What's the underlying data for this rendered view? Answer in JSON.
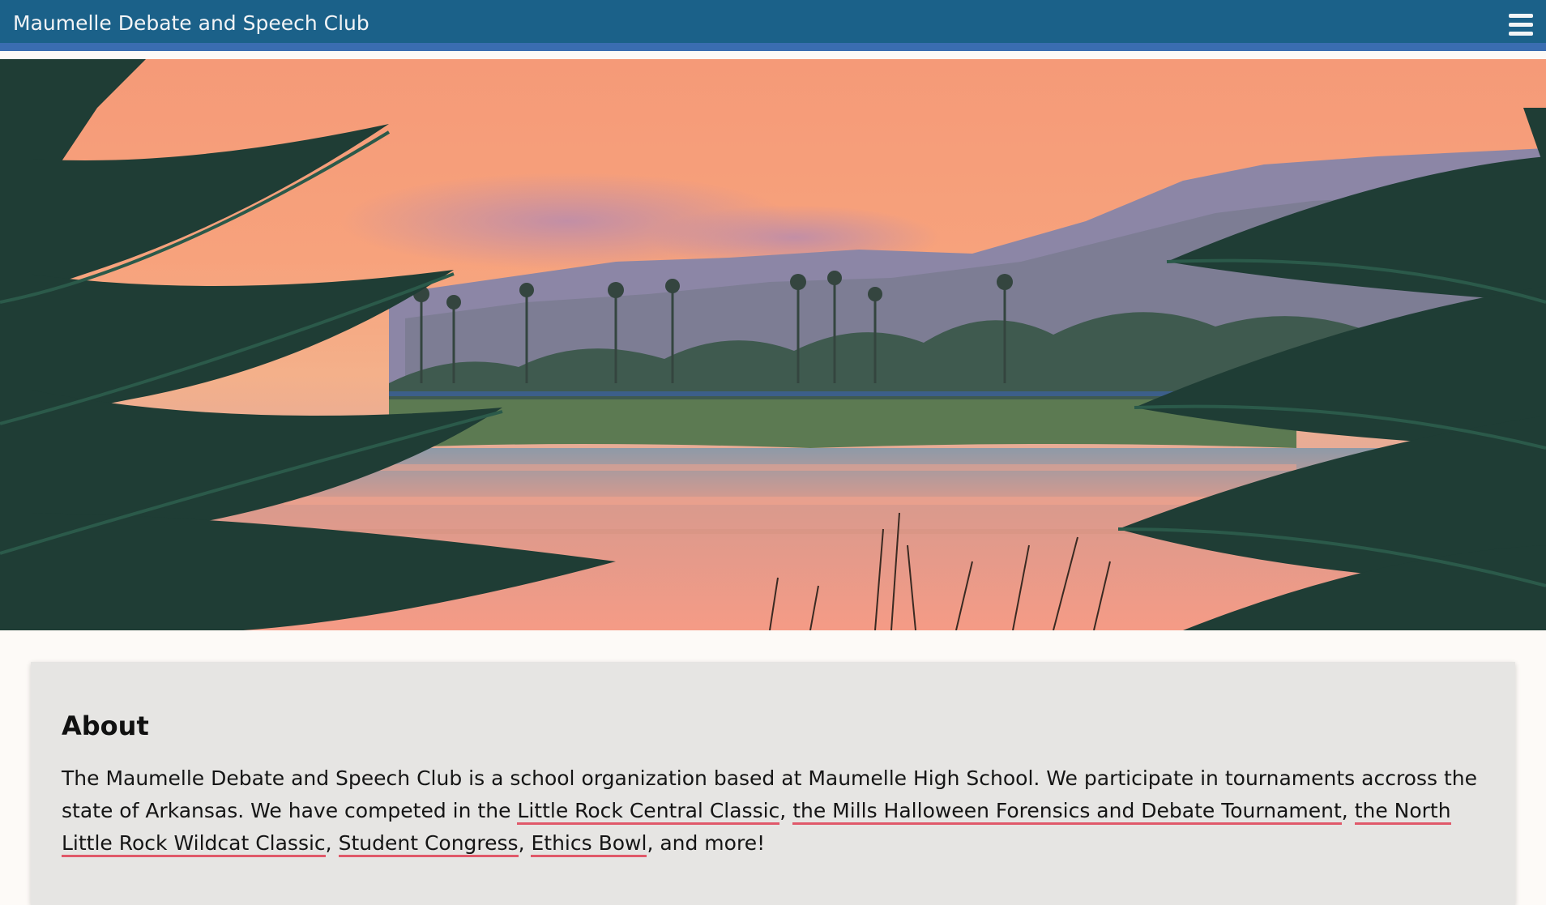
{
  "header": {
    "site_title": "Maumelle Debate and Speech Club",
    "menu_icon": "hamburger-menu-icon"
  },
  "hero": {
    "image": "sunset-lake-with-palm-fronds"
  },
  "about": {
    "heading": "About",
    "intro": "The Maumelle Debate and Speech Club is a school organization based at Maumelle High School. We participate in tournaments accross the state of Arkansas. We have competed in the ",
    "links": [
      "Little Rock Central Classic",
      "the Mills Halloween Forensics and Debate Tournament",
      "the North Little Rock Wildcat Classic",
      "Student Congress",
      "Ethics Bowl"
    ],
    "separator": ", ",
    "outro": ", and more!"
  },
  "colors": {
    "navbar": "#1b6189",
    "navbar_border": "#3a6db1",
    "card_bg": "#e6e5e3",
    "link_underline": "#e0596a"
  }
}
